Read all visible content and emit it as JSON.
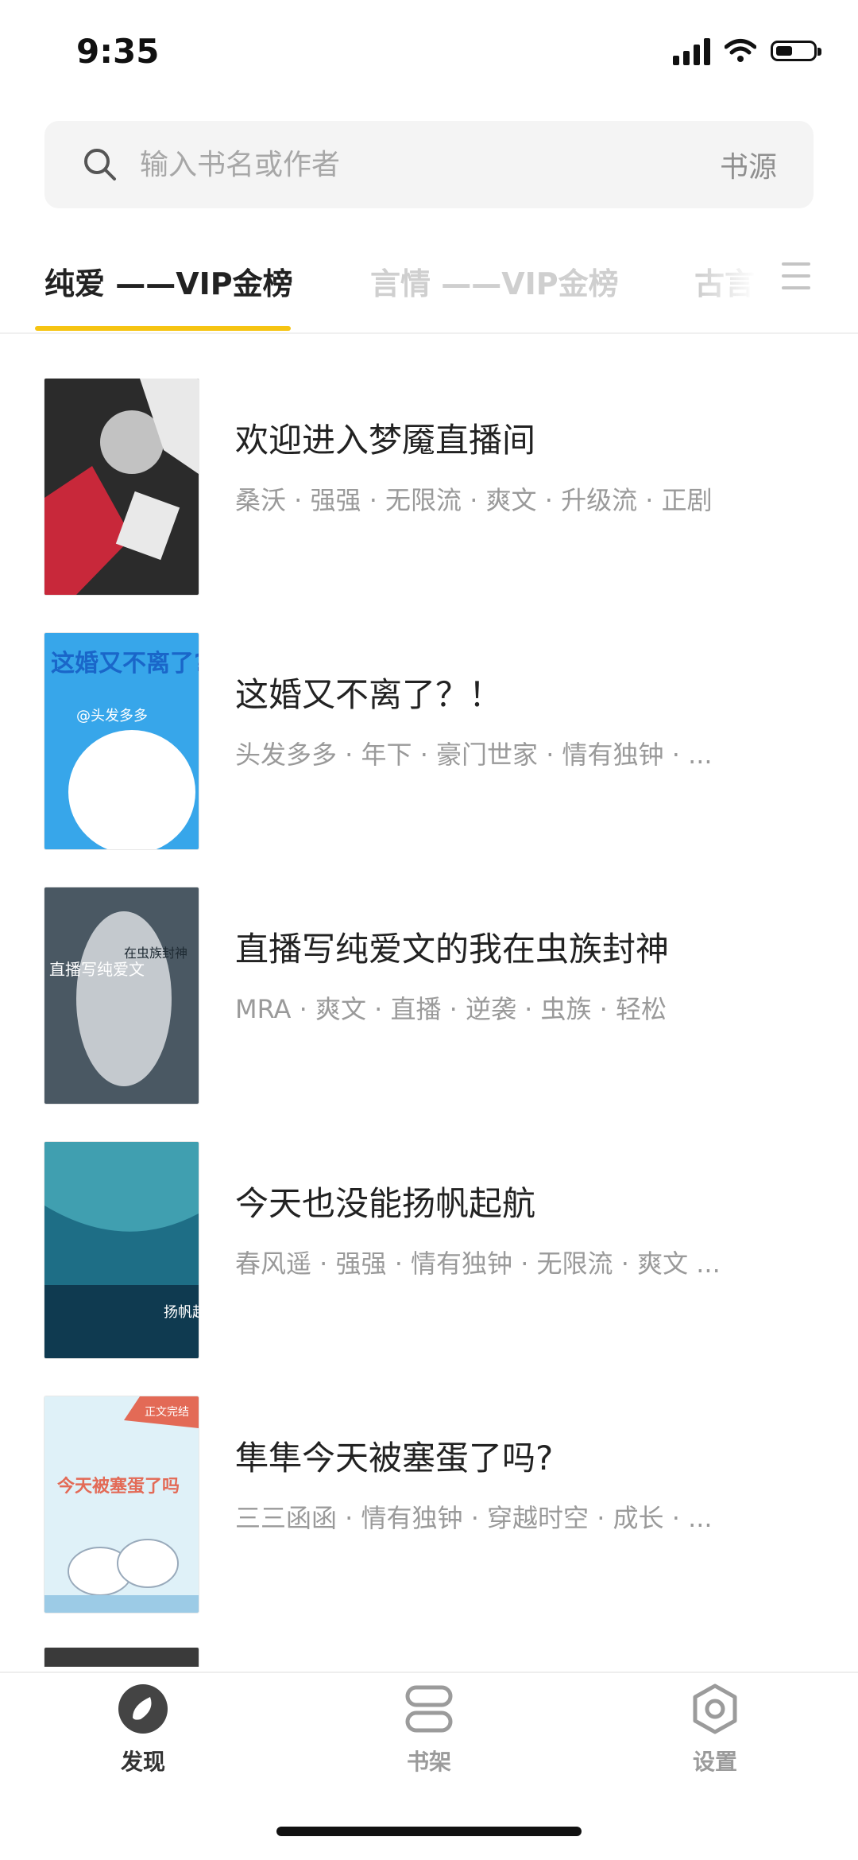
{
  "status_bar": {
    "time": "9:35",
    "battery_percent": 45
  },
  "search": {
    "placeholder": "输入书名或作者",
    "source_label": "书源"
  },
  "tabs": [
    {
      "label": "纯爱 ——VIP金榜",
      "active": true
    },
    {
      "label": "言情 ——VIP金榜",
      "active": false
    },
    {
      "label": "古言",
      "active": false
    }
  ],
  "books": [
    {
      "title": "欢迎进入梦魇直播间",
      "meta": "桑沃 · 强强 · 无限流 · 爽文 · 升级流 · 正剧"
    },
    {
      "title": "这婚又不离了？！",
      "meta": "头发多多 · 年下 · 豪门世家 · 情有独钟 · ..."
    },
    {
      "title": "直播写纯爱文的我在虫族封神",
      "meta": "MRA · 爽文 · 直播 · 逆袭 · 虫族 · 轻松"
    },
    {
      "title": "今天也没能扬帆起航",
      "meta": "春风遥 · 强强 · 情有独钟 · 无限流 · 爽文 ..."
    },
    {
      "title": "隼隼今天被塞蛋了吗?",
      "meta": "三三函函 · 情有独钟 · 穿越时空 · 成长 · ..."
    }
  ],
  "covers": [
    {
      "text": "",
      "subtext": "",
      "colors": [
        "#2b2b2b",
        "#c8283a",
        "#e9e9e9"
      ]
    },
    {
      "text": "这婚又不离了?!",
      "subtext": "@头发多多",
      "colors": [
        "#37a6ea",
        "#ffffff",
        "#1a66c9"
      ]
    },
    {
      "text": "直播写纯爱文",
      "subtext": "在虫族封神",
      "colors": [
        "#4a5863",
        "#d9dde0",
        "#1e2a33"
      ]
    },
    {
      "text": "扬帆起航",
      "subtext": "",
      "colors": [
        "#1e6e86",
        "#4fb3c2",
        "#0f3a50"
      ]
    },
    {
      "text": "今天被塞蛋了吗",
      "subtext": "正文完结",
      "colors": [
        "#dff1f8",
        "#e36a56",
        "#9ccbe6"
      ]
    }
  ],
  "bottom_nav": [
    {
      "label": "发现",
      "icon": "compass-icon",
      "active": true
    },
    {
      "label": "书架",
      "icon": "bookshelf-icon",
      "active": false
    },
    {
      "label": "设置",
      "icon": "settings-icon",
      "active": false
    }
  ]
}
